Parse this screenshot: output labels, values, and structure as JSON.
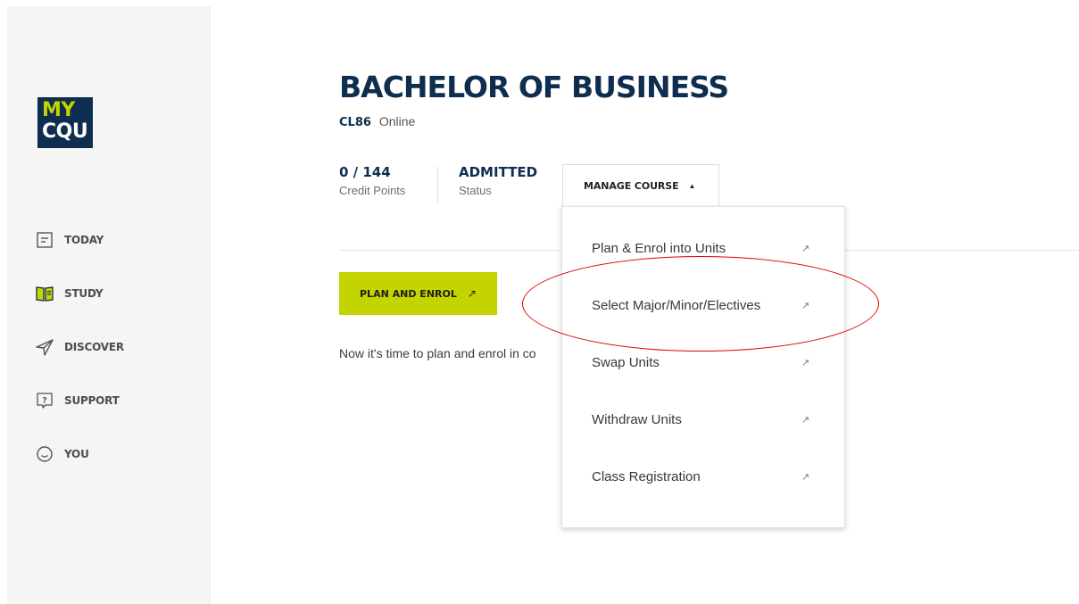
{
  "logo": {
    "line1": "MY",
    "line2": "CQU"
  },
  "nav": [
    {
      "label": "TODAY",
      "icon": "document-icon"
    },
    {
      "label": "STUDY",
      "icon": "book-icon"
    },
    {
      "label": "DISCOVER",
      "icon": "send-icon"
    },
    {
      "label": "SUPPORT",
      "icon": "question-icon"
    },
    {
      "label": "YOU",
      "icon": "smiley-icon"
    }
  ],
  "course": {
    "title": "BACHELOR OF BUSINESS",
    "code": "CL86",
    "mode": "Online",
    "credit_value": "0 / 144",
    "credit_label": "Credit Points",
    "status_value": "ADMITTED",
    "status_label": "Status"
  },
  "manage": {
    "label": "MANAGE COURSE",
    "caret": "▲"
  },
  "plan_button": {
    "label": "PLAN AND ENROL",
    "arrow": "↗"
  },
  "intro_text": "Now it's time to plan and enrol in co",
  "dropdown": [
    {
      "label": "Plan & Enrol into Units",
      "arrow": "↗"
    },
    {
      "label": "Select Major/Minor/Electives",
      "arrow": "↗"
    },
    {
      "label": "Swap Units",
      "arrow": "↗"
    },
    {
      "label": "Withdraw Units",
      "arrow": "↗"
    },
    {
      "label": "Class Registration",
      "arrow": "↗"
    }
  ],
  "colors": {
    "navy": "#0e2d4f",
    "lime": "#c3d400",
    "highlight_ring": "#e00000",
    "sidebar_bg": "#f5f5f3"
  }
}
